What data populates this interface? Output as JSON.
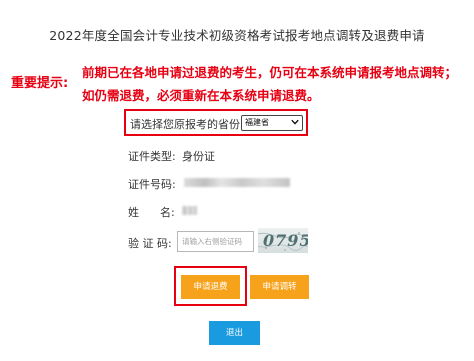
{
  "page": {
    "title": "2022年度全国会计专业技术初级资格考试报考地点调转及退费申请"
  },
  "notice": {
    "label": "重要提示:",
    "line1": "前期已在各地申请过退费的考生，仍可在本系统申请报考地点调转；",
    "line2": "如仍需退费，必须重新在本系统申请退费。"
  },
  "province": {
    "label": "请选择您原报考的省份:",
    "selected": "福建省"
  },
  "form": {
    "id_type_label": "证件类型:",
    "id_type_value": "身份证",
    "id_number_label": "证件号码:",
    "name_label": "姓      名:",
    "captcha_label": "验 证 码:",
    "captcha_placeholder": "请输入右侧验证码",
    "captcha_code": "0795"
  },
  "buttons": {
    "refund": "申请退费",
    "transfer": "申请调转",
    "exit": "退出"
  },
  "colors": {
    "notice_red": "#e60012",
    "orange_button": "#f7a21b",
    "blue_button": "#1a9be0"
  }
}
